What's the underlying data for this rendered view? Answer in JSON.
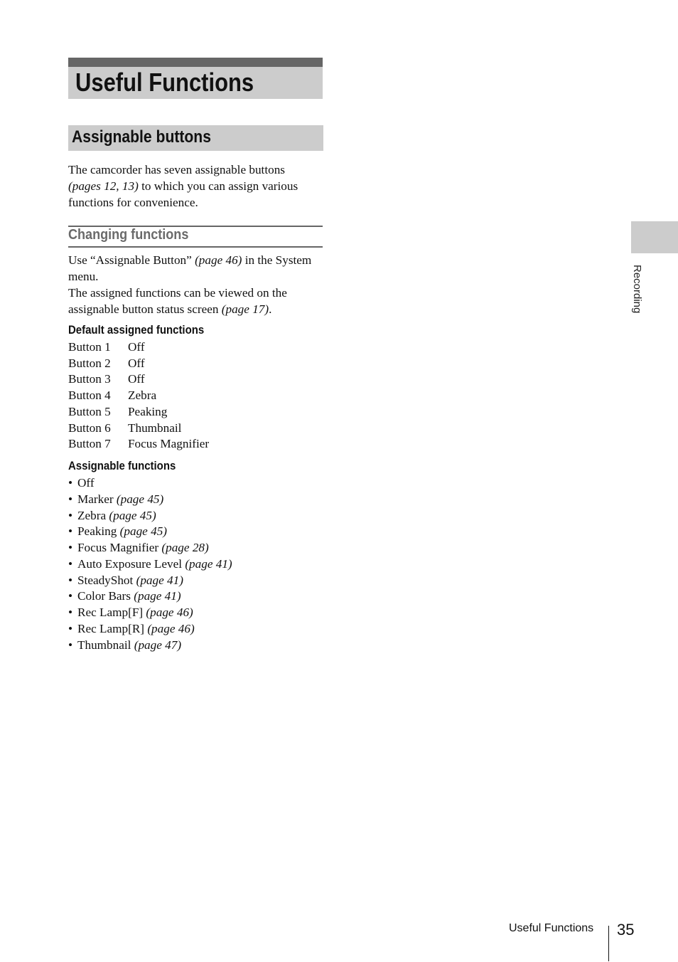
{
  "chapter": {
    "title": "Useful Functions"
  },
  "section": {
    "title": "Assignable buttons"
  },
  "intro": {
    "line1": "The camcorder has seven assignable buttons",
    "ref": "(pages 12, 13)",
    "line2_rest": " to which you can assign various",
    "line3": "functions for convenience."
  },
  "changing": {
    "heading": "Changing functions",
    "p1_start": "Use “Assignable Button” ",
    "p1_ref": "(page 46)",
    "p1_end": " in the System menu.",
    "p2_start": "The assigned functions can be viewed on the assignable button status screen ",
    "p2_ref": "(page 17)",
    "p2_end": "."
  },
  "defaults": {
    "heading": "Default assigned functions",
    "rows": [
      {
        "button": "Button 1",
        "function": "Off"
      },
      {
        "button": "Button 2",
        "function": "Off"
      },
      {
        "button": "Button 3",
        "function": "Off"
      },
      {
        "button": "Button 4",
        "function": "Zebra"
      },
      {
        "button": "Button 5",
        "function": "Peaking"
      },
      {
        "button": "Button 6",
        "function": "Thumbnail"
      },
      {
        "button": "Button 7",
        "function": "Focus Magnifier"
      }
    ]
  },
  "assignable": {
    "heading": "Assignable functions",
    "bullet": "•",
    "items": [
      {
        "name": "Off",
        "ref": ""
      },
      {
        "name": "Marker",
        "ref": "(page 45)"
      },
      {
        "name": "Zebra",
        "ref": "(page 45)"
      },
      {
        "name": "Peaking",
        "ref": "(page 45)"
      },
      {
        "name": "Focus Magnifier",
        "ref": "(page 28)"
      },
      {
        "name": "Auto Exposure Level",
        "ref": "(page 41)"
      },
      {
        "name": "SteadyShot",
        "ref": "(page 41)"
      },
      {
        "name": "Color Bars",
        "ref": "(page 41)"
      },
      {
        "name": "Rec Lamp[F]",
        "ref": "(page 46)"
      },
      {
        "name": "Rec Lamp[R]",
        "ref": "(page 46)"
      },
      {
        "name": "Thumbnail",
        "ref": "(page 47)"
      }
    ]
  },
  "side_tab": {
    "label": "Recording"
  },
  "footer": {
    "section": "Useful Functions",
    "page": "35"
  },
  "colors": {
    "header_bar": "#666666",
    "header_bg": "#cccccc",
    "subhead": "#6a6a6a"
  }
}
